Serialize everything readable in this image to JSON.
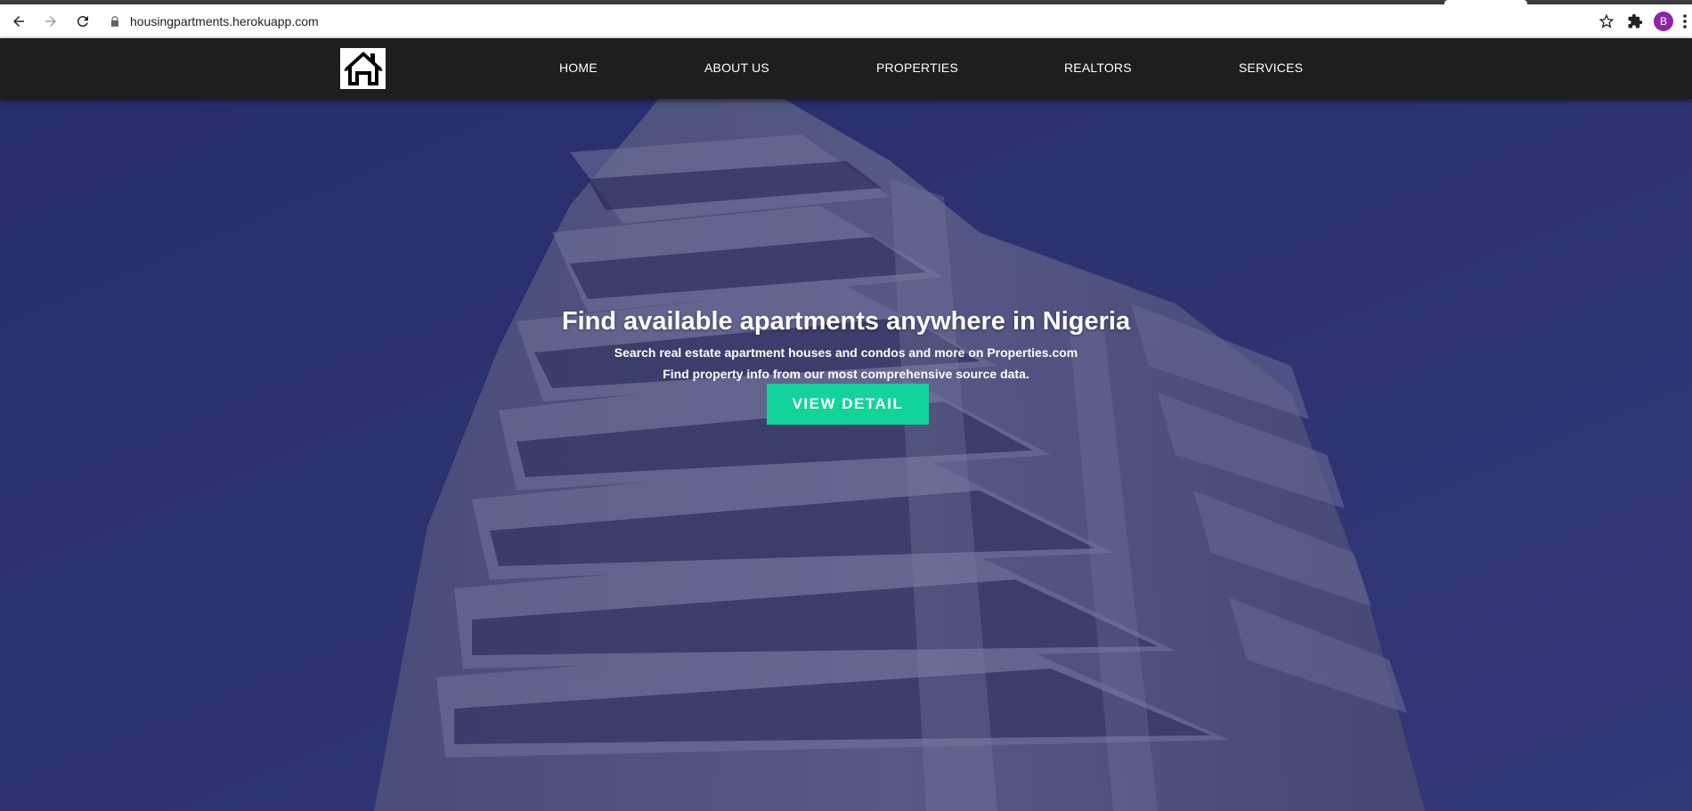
{
  "browser": {
    "url": "housingpartments.herokuapp.com",
    "profile_initial": "B",
    "profile_color": "#8e24aa",
    "icons": [
      "back-arrow-icon",
      "forward-arrow-icon",
      "reload-icon",
      "lock-icon",
      "star-icon",
      "extensions-puzzle-icon",
      "kebab-menu-icon"
    ]
  },
  "header": {
    "logo_icon": "house-icon",
    "nav": [
      {
        "label": "HOME"
      },
      {
        "label": "ABOUT US"
      },
      {
        "label": "PROPERTIES"
      },
      {
        "label": "REALTORS"
      },
      {
        "label": "SERVICES"
      }
    ]
  },
  "hero": {
    "title": "Find available apartments anywhere in Nigeria",
    "subtitle_line1": "Search real estate apartment houses and condos and more on Properties.com",
    "subtitle_line2": "Find property info from our most comprehensive source data.",
    "cta_label": "VIEW DETAIL",
    "cta_color": "#14d39a",
    "background": "high-rise apartment building photo with blue overlay"
  }
}
